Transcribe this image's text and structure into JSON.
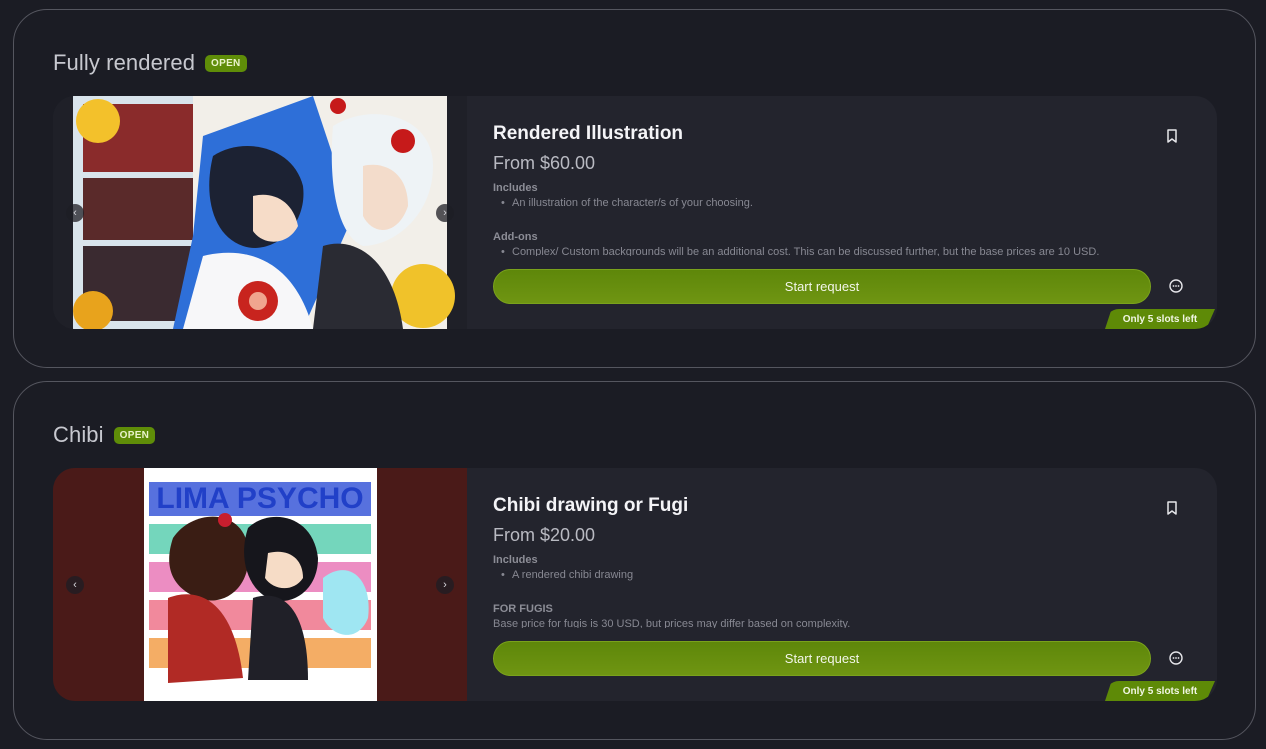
{
  "sections": [
    {
      "title": "Fully rendered",
      "badge": "OPEN",
      "card": {
        "title": "Rendered Illustration",
        "price": "From $60.00",
        "includes_heading": "Includes",
        "includes_item": "An illustration of the character/s of your choosing.",
        "extra_heading": "Add-ons",
        "extra_text": "Complex/ Custom backgrounds will be an additional cost. This can be discussed further, but the base prices are 10 USD.",
        "button": "Start request",
        "slots": "Only 5 slots left",
        "prev": "‹",
        "next": "›"
      }
    },
    {
      "title": "Chibi",
      "badge": "OPEN",
      "card": {
        "title": "Chibi drawing or Fugi",
        "price": "From $20.00",
        "includes_heading": "Includes",
        "includes_item": "A rendered chibi drawing",
        "extra_heading": "FOR FUGIS",
        "extra_text": "Base price for fugis is 30 USD, but prices may differ based on complexity.",
        "button": "Start request",
        "slots": "Only 5 slots left",
        "prev": "‹",
        "next": "›",
        "image_text": "LIMA PSYCHO"
      }
    }
  ],
  "colors": {
    "accent": "#6a9210",
    "background": "#1b1c24",
    "card": "#23242d"
  },
  "icons": [
    "bookmark-icon",
    "chat-icon",
    "chevron-left-icon",
    "chevron-right-icon"
  ]
}
